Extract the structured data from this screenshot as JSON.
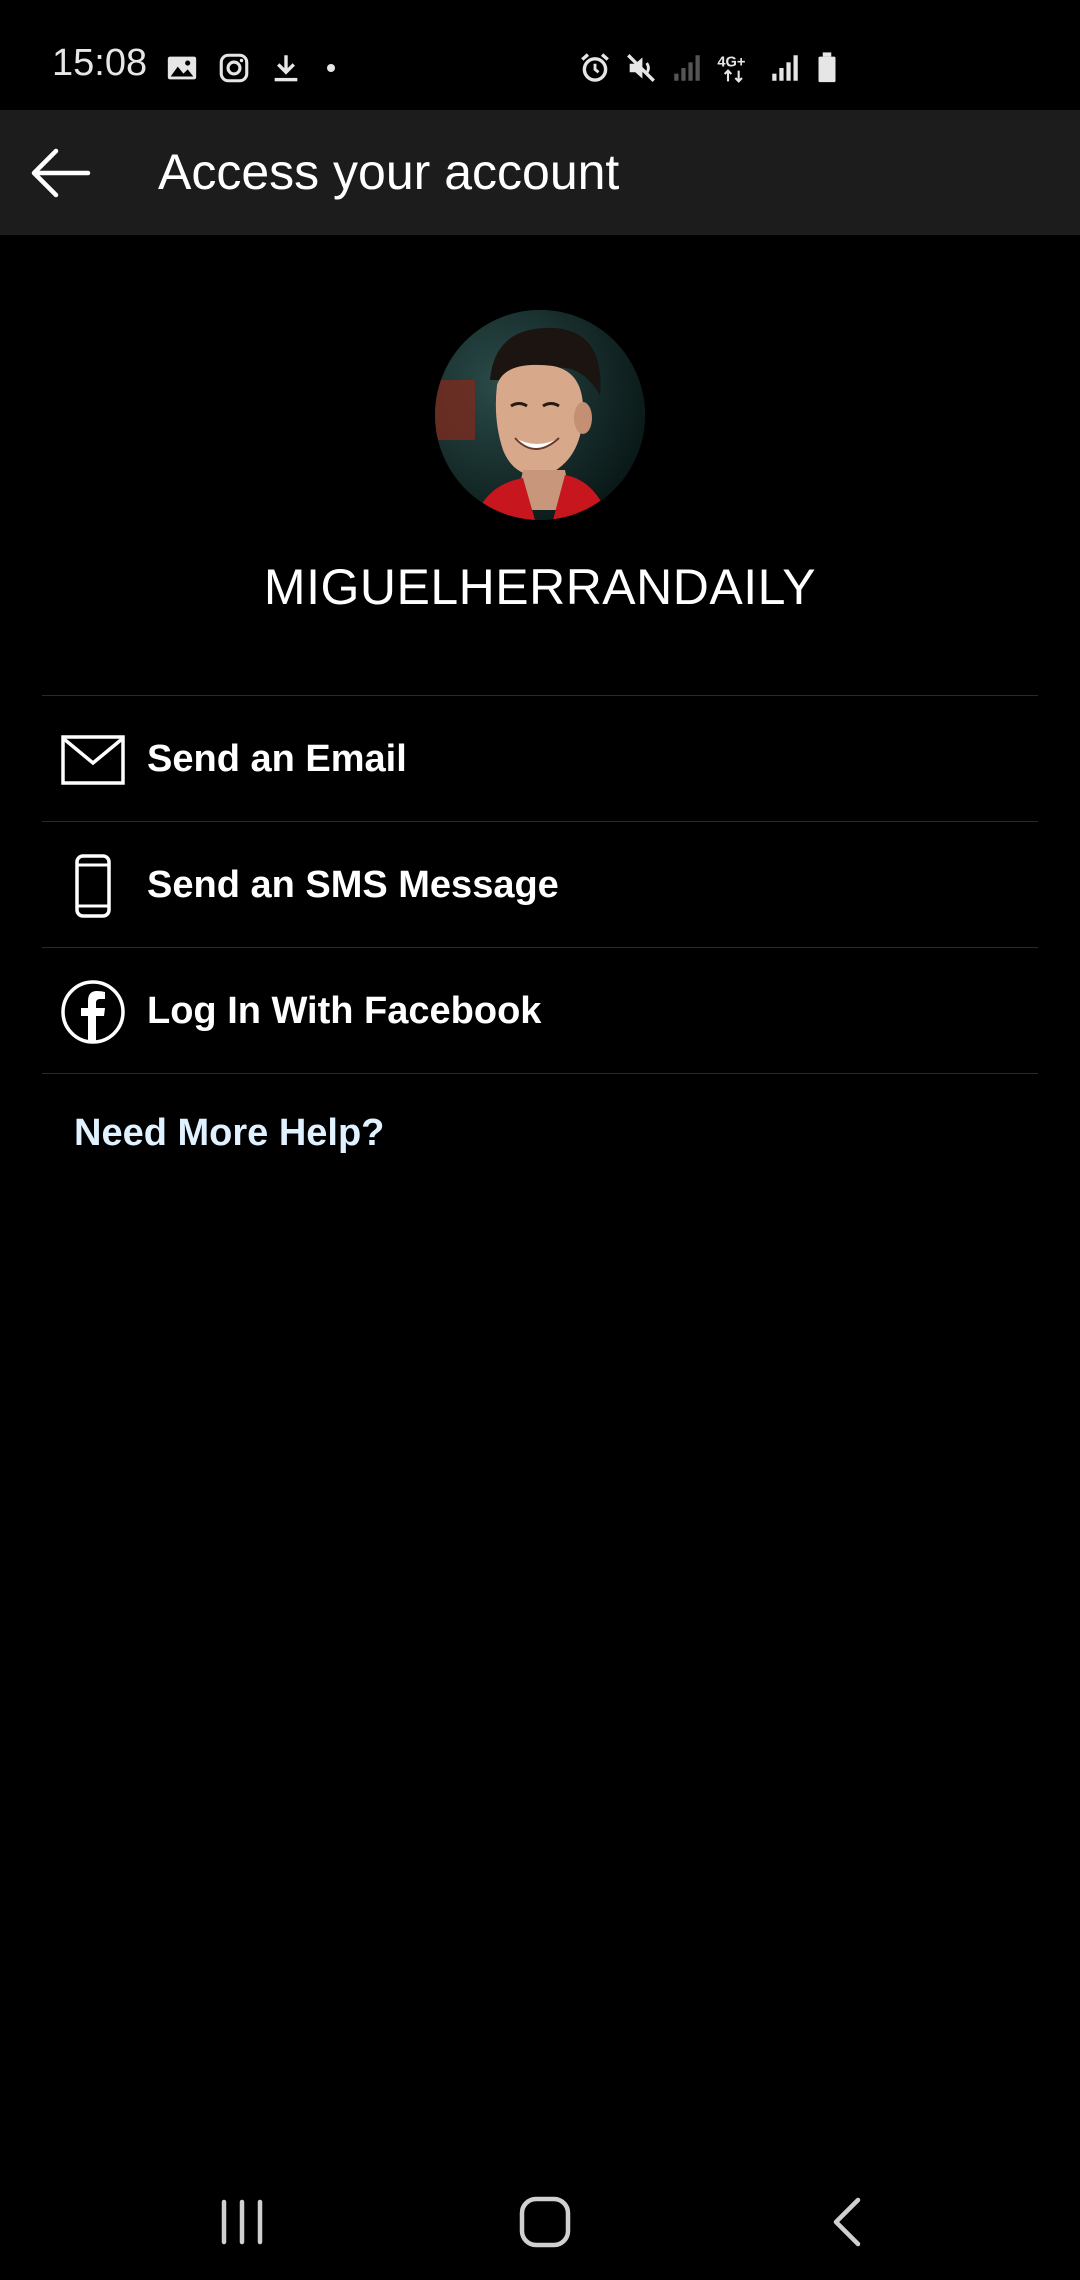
{
  "status_bar": {
    "time": "15:08",
    "network_label": "4G+",
    "left_icons": [
      "gallery-icon",
      "instagram-icon",
      "download-icon",
      "dot-icon"
    ],
    "right_icons": [
      "alarm-icon",
      "mute-icon",
      "signal-weak-icon",
      "network-4g-icon",
      "signal-icon",
      "battery-icon"
    ]
  },
  "app_bar": {
    "title": "Access your account",
    "back_icon": "arrow-left-icon"
  },
  "profile": {
    "username": "MIGUELHERRANDAILY"
  },
  "options": [
    {
      "label": "Send an Email",
      "icon": "mail-icon"
    },
    {
      "label": "Send an SMS Message",
      "icon": "phone-icon"
    },
    {
      "label": "Log In With Facebook",
      "icon": "facebook-icon"
    }
  ],
  "help": {
    "label": "Need More Help?"
  },
  "nav_bar": {
    "buttons": [
      "recents-icon",
      "home-icon",
      "back-icon"
    ]
  },
  "colors": {
    "background": "#000000",
    "app_bar": "#1c1c1c",
    "divider": "#2b2b2b",
    "help_link": "#e0f1ff"
  }
}
